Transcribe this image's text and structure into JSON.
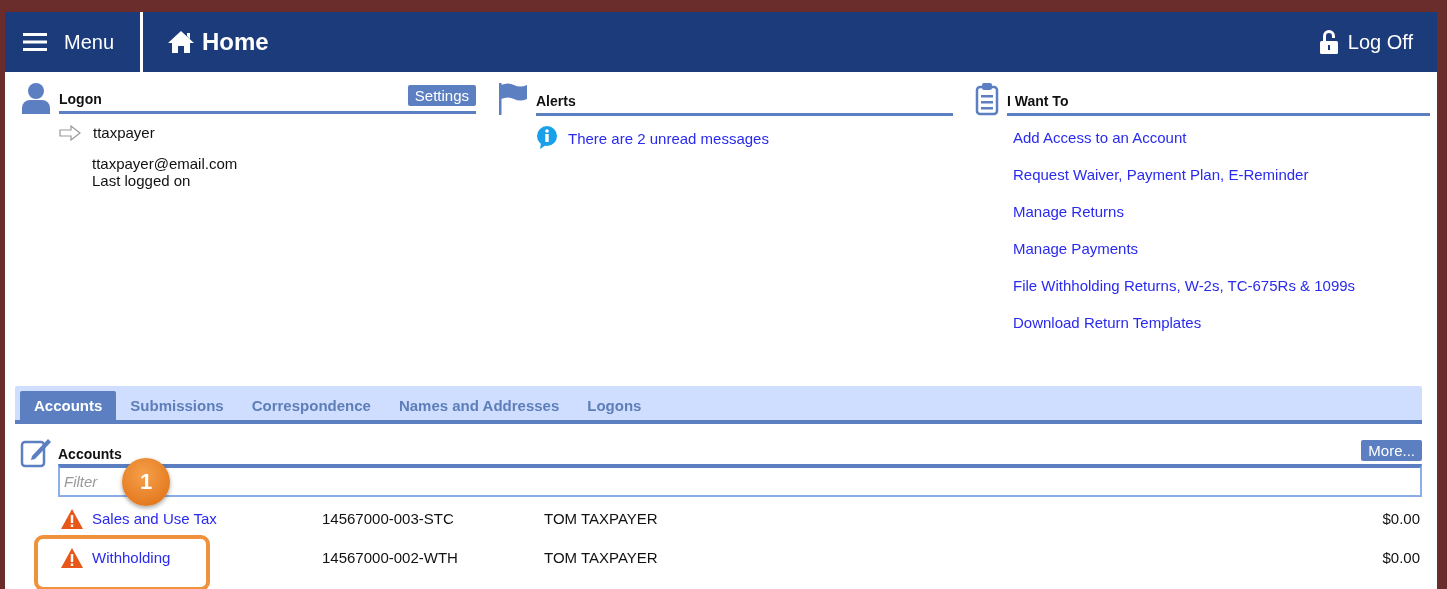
{
  "header": {
    "menu_label": "Menu",
    "title": "Home",
    "logoff_label": "Log Off"
  },
  "logon": {
    "heading": "Logon",
    "settings_button": "Settings",
    "username": "ttaxpayer",
    "email": "ttaxpayer@email.com",
    "last_logged": "Last logged on"
  },
  "alerts": {
    "heading": "Alerts",
    "message": "There are 2 unread messages"
  },
  "i_want_to": {
    "heading": "I Want To",
    "links": [
      "Add Access to an Account",
      "Request Waiver, Payment Plan, E-Reminder",
      "Manage Returns",
      "Manage Payments",
      "File Withholding Returns, W-2s, TC-675Rs & 1099s",
      "Download Return Templates"
    ]
  },
  "tabs": [
    {
      "label": "Accounts",
      "selected": true
    },
    {
      "label": "Submissions",
      "selected": false
    },
    {
      "label": "Correspondence",
      "selected": false
    },
    {
      "label": "Names and Addresses",
      "selected": false
    },
    {
      "label": "Logons",
      "selected": false
    }
  ],
  "accounts": {
    "heading": "Accounts",
    "more_button": "More...",
    "filter": {
      "placeholder": "Filter"
    },
    "rows": [
      {
        "name": "Sales and Use Tax",
        "account": "14567000-003-STC",
        "owner": "TOM TAXPAYER",
        "balance": "$0.00",
        "warning": true,
        "highlighted": false
      },
      {
        "name": "Withholding",
        "account": "14567000-002-WTH",
        "owner": "TOM TAXPAYER",
        "balance": "$0.00",
        "warning": true,
        "highlighted": true
      }
    ]
  },
  "callout": {
    "number": "1"
  }
}
